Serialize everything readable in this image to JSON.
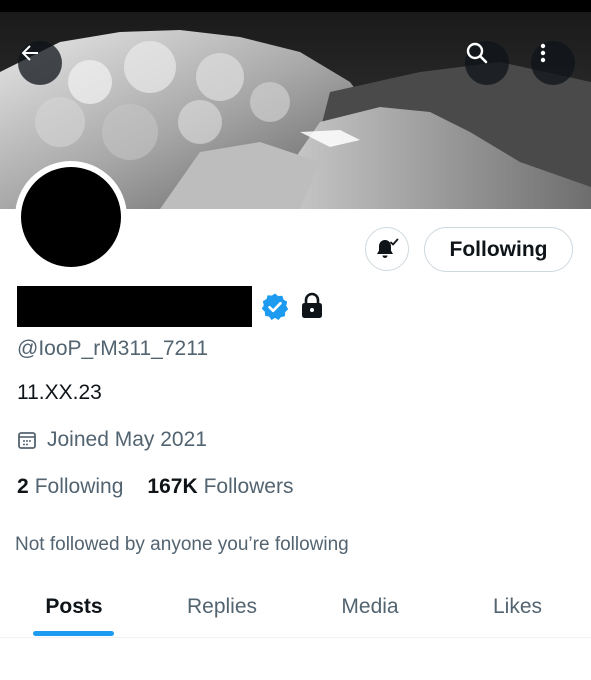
{
  "header": {
    "back_icon": "arrow-left-icon",
    "search_icon": "search-icon",
    "more_icon": "more-vertical-icon"
  },
  "profile": {
    "handle": "@IooP_rM311_7211",
    "bio": "11.XX.23",
    "joined": "Joined May 2021",
    "following_count": "2",
    "following_label": "Following",
    "followers_count": "167K",
    "followers_label": "Followers",
    "not_followed_text": "Not followed by anyone you’re following",
    "verified": true,
    "protected": true
  },
  "actions": {
    "notification_icon": "bell-check-icon",
    "follow_button_label": "Following"
  },
  "tabs": [
    {
      "label": "Posts",
      "active": true
    },
    {
      "label": "Replies",
      "active": false
    },
    {
      "label": "Media",
      "active": false
    },
    {
      "label": "Likes",
      "active": false
    }
  ],
  "colors": {
    "accent": "#1d9bf0",
    "text_primary": "#0f1419",
    "text_secondary": "#536471",
    "border": "#cfd9de"
  }
}
